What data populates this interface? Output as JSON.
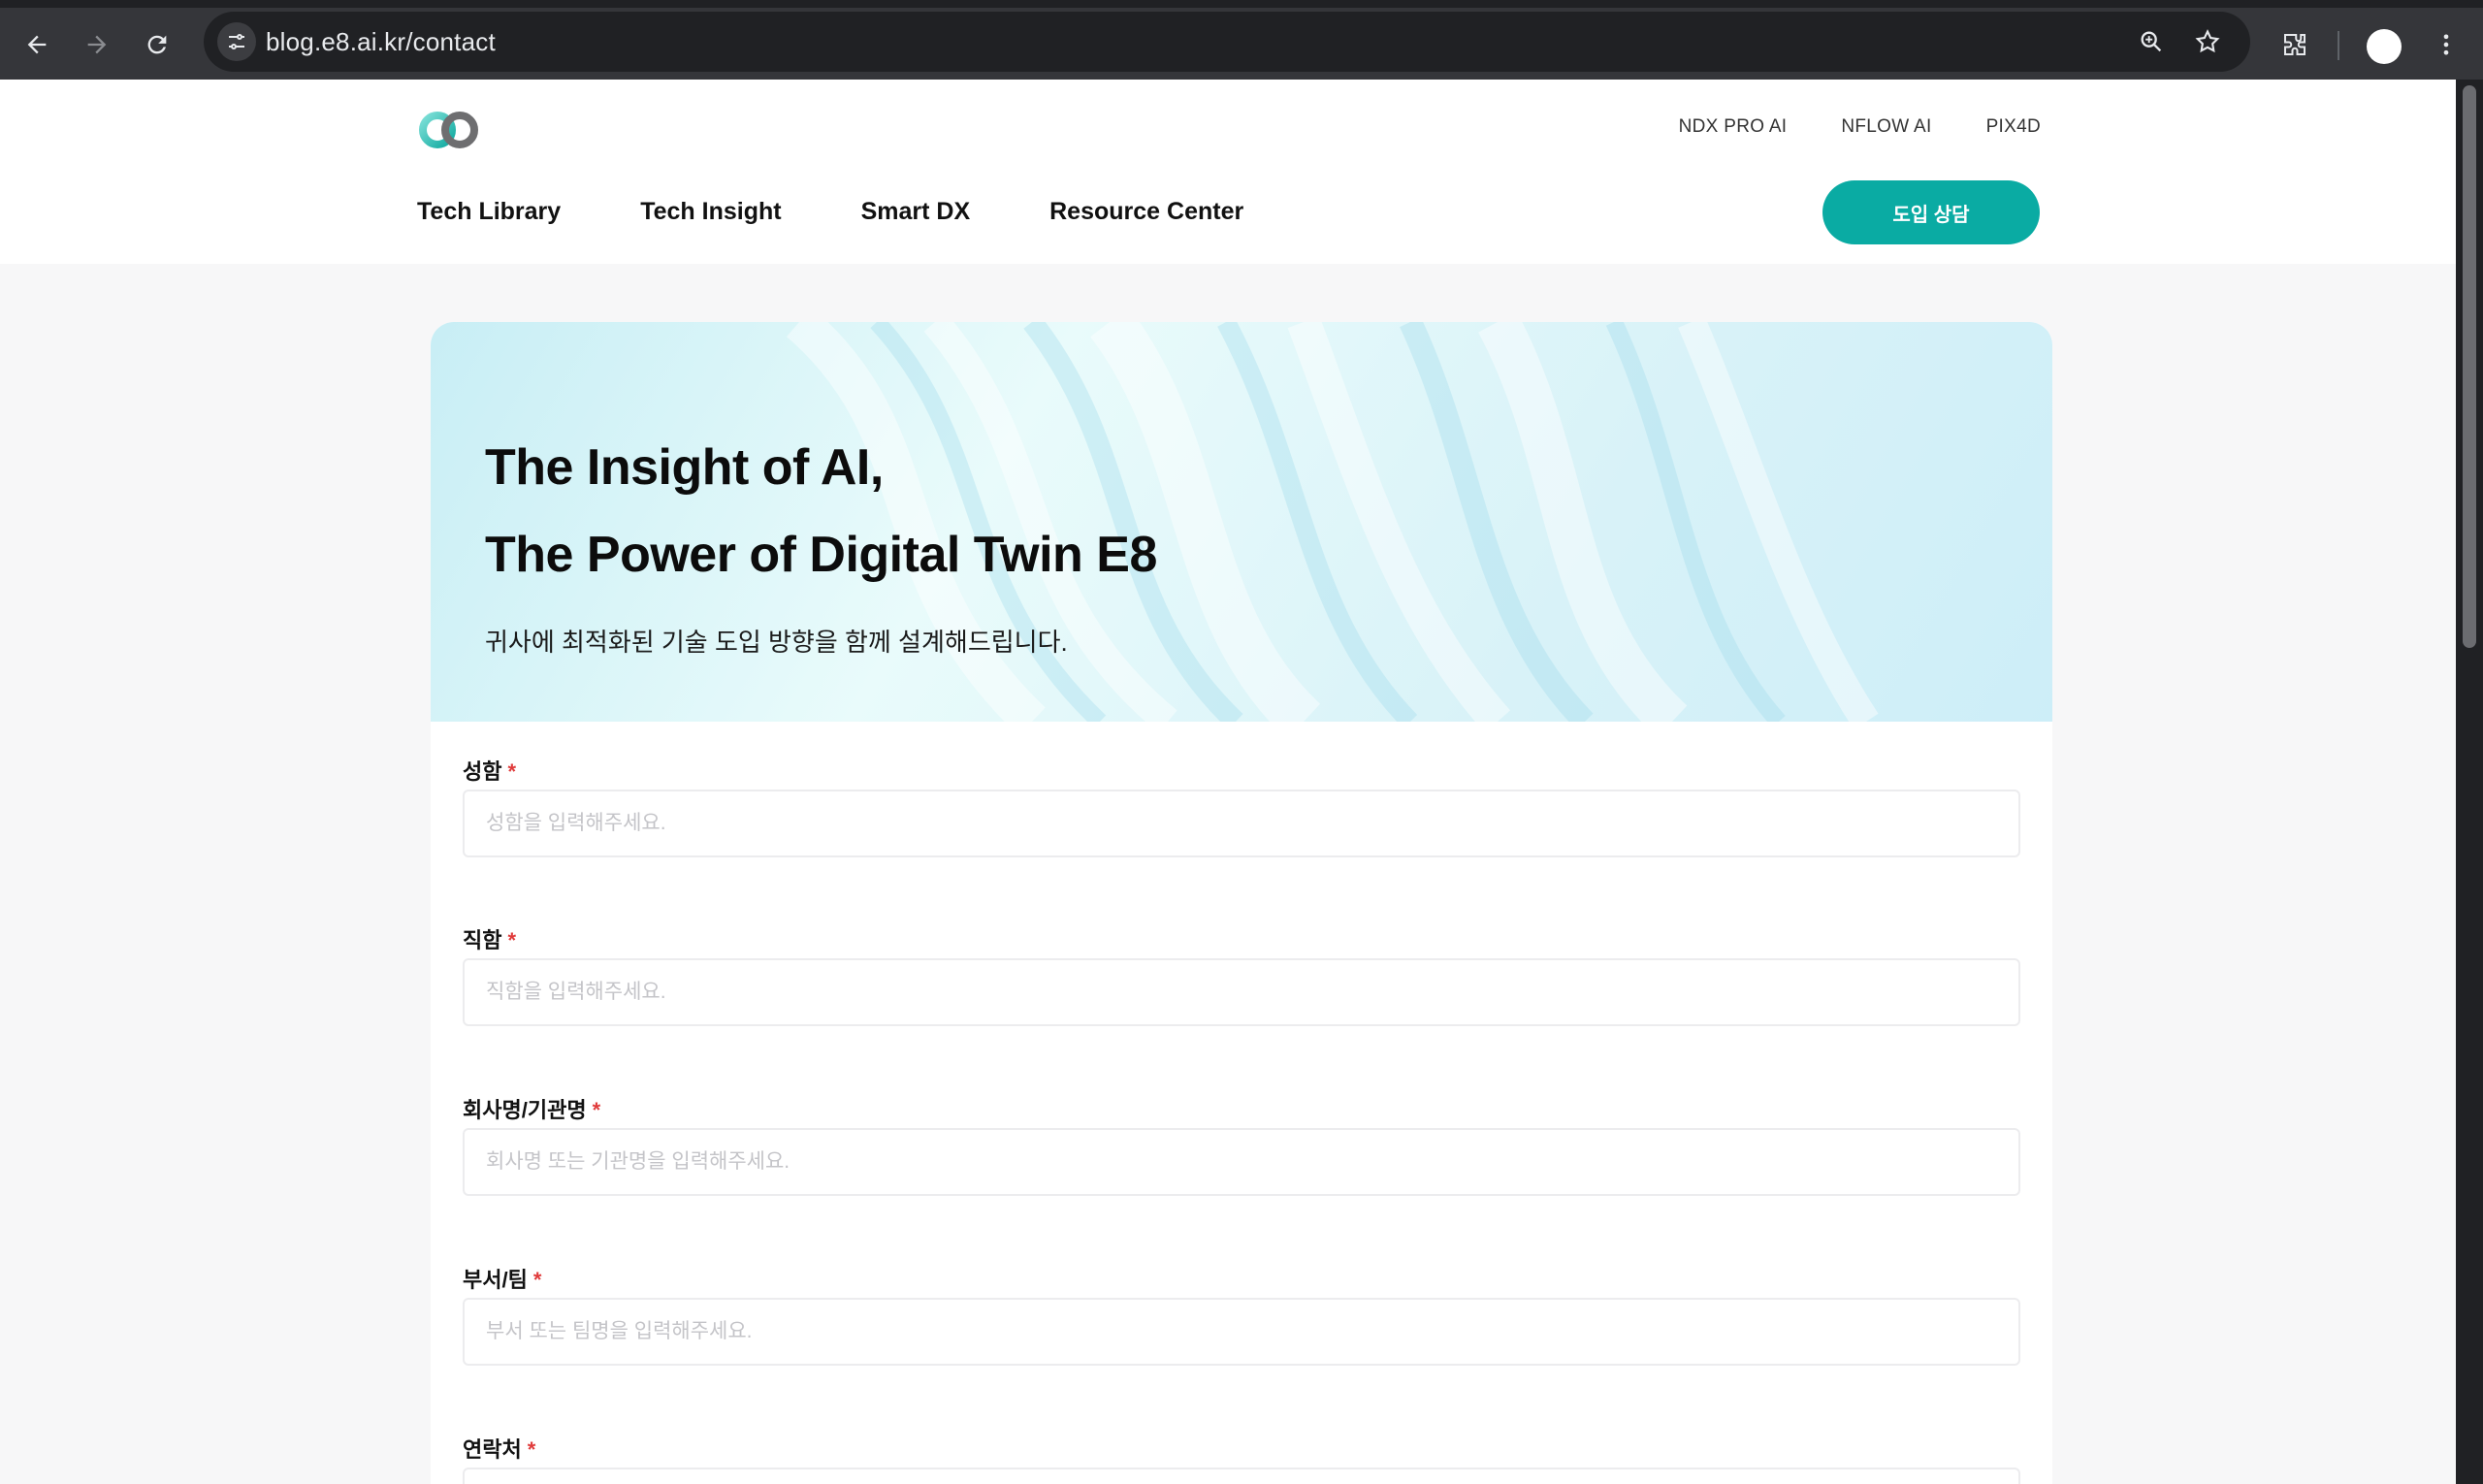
{
  "browser": {
    "url": "blog.e8.ai.kr/contact"
  },
  "header": {
    "top_links": [
      "NDX PRO AI",
      "NFLOW AI",
      "PIX4D"
    ],
    "nav": [
      "Tech Library",
      "Tech Insight",
      "Smart DX",
      "Resource Center"
    ],
    "cta_label": "도입 상담"
  },
  "hero": {
    "title_line1": "The Insight of AI,",
    "title_line2": "The Power of Digital Twin E8",
    "subtitle": "귀사에 최적화된 기술 도입 방향을 함께 설계해드립니다."
  },
  "form": {
    "required_mark": "*",
    "fields": [
      {
        "label": "성함",
        "placeholder": "성함을 입력해주세요.",
        "value": ""
      },
      {
        "label": "직함",
        "placeholder": "직함을 입력해주세요.",
        "value": ""
      },
      {
        "label": "회사명/기관명",
        "placeholder": "회사명 또는 기관명을 입력해주세요.",
        "value": ""
      },
      {
        "label": "부서/팀",
        "placeholder": "부서 또는 팀명을 입력해주세요.",
        "value": ""
      },
      {
        "label": "연락처",
        "placeholder": "",
        "value": ""
      }
    ]
  },
  "colors": {
    "accent": "#0aaba3",
    "required": "#e03b3b",
    "chrome_bg": "#35363a"
  }
}
